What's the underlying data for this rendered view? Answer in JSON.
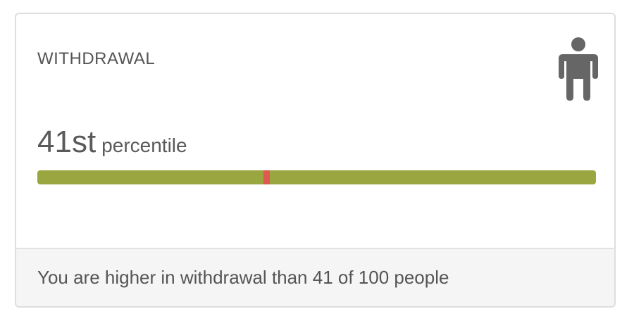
{
  "card": {
    "title": "WITHDRAWAL",
    "icon": "person-icon",
    "percentile_value": "41st",
    "percentile_unit": "percentile",
    "percentile_number": 41,
    "bar": {
      "min": 0,
      "max": 100,
      "value": 41,
      "track_color": "#9aa63f",
      "marker_color": "#de5a4e"
    },
    "footer_text": "You are higher in withdrawal than 41 of 100 people"
  },
  "colors": {
    "text": "#555555",
    "icon": "#666666",
    "footer_bg": "#f5f5f5",
    "border": "#dedede"
  }
}
